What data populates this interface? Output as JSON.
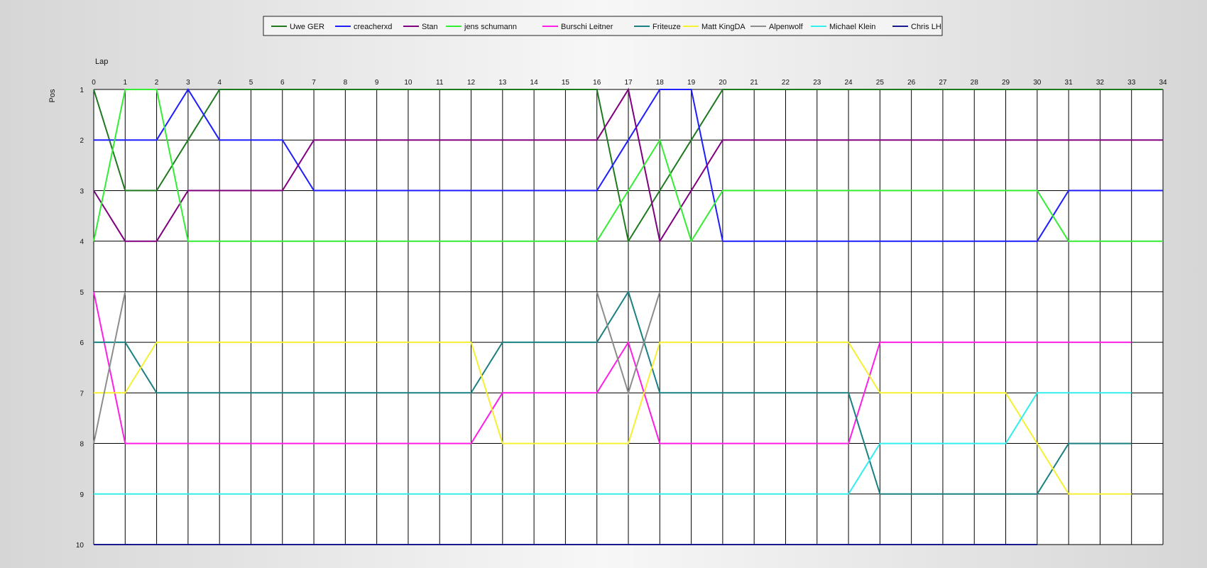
{
  "chart_data": {
    "type": "line",
    "xlabel": "Lap",
    "ylabel": "Pos",
    "xlim": [
      0,
      34
    ],
    "ylim": [
      1,
      10
    ],
    "y_inverted": true,
    "grid": true,
    "legend_placement": "top-center",
    "x_ticks": [
      "0",
      "1",
      "2",
      "3",
      "4",
      "5",
      "6",
      "7",
      "8",
      "9",
      "10",
      "11",
      "12",
      "13",
      "14",
      "15",
      "16",
      "17",
      "18",
      "19",
      "20",
      "21",
      "22",
      "23",
      "24",
      "25",
      "26",
      "27",
      "28",
      "29",
      "30",
      "31",
      "32",
      "33",
      "34"
    ],
    "y_ticks": [
      "1",
      "2",
      "3",
      "4",
      "5",
      "6",
      "7",
      "8",
      "9",
      "10"
    ],
    "series": [
      {
        "name": "Uwe GER",
        "color": "#1f7a1f",
        "values": [
          1,
          3,
          3,
          2,
          1,
          1,
          1,
          1,
          1,
          1,
          1,
          1,
          1,
          1,
          1,
          1,
          1,
          4,
          3,
          2,
          1,
          1,
          1,
          1,
          1,
          1,
          1,
          1,
          1,
          1,
          1,
          1,
          1,
          1,
          1
        ]
      },
      {
        "name": "creacherxd",
        "color": "#1e1eff",
        "values": [
          2,
          2,
          2,
          1,
          2,
          2,
          2,
          3,
          3,
          3,
          3,
          3,
          3,
          3,
          3,
          3,
          3,
          2,
          1,
          1,
          4,
          4,
          4,
          4,
          4,
          4,
          4,
          4,
          4,
          4,
          4,
          3,
          3,
          3,
          3
        ]
      },
      {
        "name": "Stan",
        "color": "#800080",
        "values": [
          3,
          4,
          4,
          3,
          3,
          3,
          3,
          2,
          2,
          2,
          2,
          2,
          2,
          2,
          2,
          2,
          2,
          1,
          4,
          3,
          2,
          2,
          2,
          2,
          2,
          2,
          2,
          2,
          2,
          2,
          2,
          2,
          2,
          2,
          2
        ]
      },
      {
        "name": "jens  schumann",
        "color": "#33ee33",
        "values": [
          4,
          1,
          1,
          4,
          4,
          4,
          4,
          4,
          4,
          4,
          4,
          4,
          4,
          4,
          4,
          4,
          4,
          3,
          2,
          4,
          3,
          3,
          3,
          3,
          3,
          3,
          3,
          3,
          3,
          3,
          3,
          4,
          4,
          4,
          4
        ]
      },
      {
        "name": "Burschi Leitner",
        "color": "#ff1ee6",
        "values": [
          5,
          8,
          8,
          8,
          8,
          8,
          8,
          8,
          8,
          8,
          8,
          8,
          8,
          7,
          7,
          7,
          7,
          6,
          8,
          8,
          8,
          8,
          8,
          8,
          8,
          6,
          6,
          6,
          6,
          6,
          6,
          6,
          6,
          6
        ]
      },
      {
        "name": "Friteuze",
        "color": "#1a8080",
        "values": [
          6,
          6,
          7,
          7,
          7,
          7,
          7,
          7,
          7,
          7,
          7,
          7,
          7,
          6,
          6,
          6,
          6,
          5,
          7,
          7,
          7,
          7,
          7,
          7,
          7,
          9,
          9,
          9,
          9,
          9,
          9,
          8,
          8,
          8
        ]
      },
      {
        "name": "Matt KingDA",
        "color": "#f5f032",
        "values": [
          7,
          7,
          6,
          6,
          6,
          6,
          6,
          6,
          6,
          6,
          6,
          6,
          6,
          8,
          8,
          8,
          8,
          8,
          6,
          6,
          6,
          6,
          6,
          6,
          6,
          7,
          7,
          7,
          7,
          7,
          8,
          9,
          9,
          9
        ]
      },
      {
        "name": "Alpenwolf",
        "color": "#8c8c8c",
        "values": [
          8,
          5,
          null,
          null,
          null,
          null,
          null,
          null,
          null,
          null,
          null,
          null,
          null,
          null,
          null,
          null,
          5,
          7,
          5
        ]
      },
      {
        "name": "Michael Klein",
        "color": "#33eeee",
        "values": [
          9,
          9,
          9,
          9,
          9,
          9,
          9,
          9,
          9,
          9,
          9,
          9,
          9,
          9,
          9,
          9,
          9,
          9,
          9,
          9,
          9,
          9,
          9,
          9,
          9,
          8,
          8,
          8,
          8,
          8,
          7,
          7,
          7,
          7
        ]
      },
      {
        "name": "Chris LH",
        "color": "#1a1a8c",
        "values": [
          10,
          10,
          10,
          10,
          10,
          10,
          10,
          10,
          10,
          10,
          10,
          10,
          10,
          10,
          10,
          10,
          10,
          10,
          10,
          10,
          10,
          10,
          10,
          10,
          10,
          10,
          10,
          10,
          10,
          10,
          10
        ]
      }
    ]
  }
}
